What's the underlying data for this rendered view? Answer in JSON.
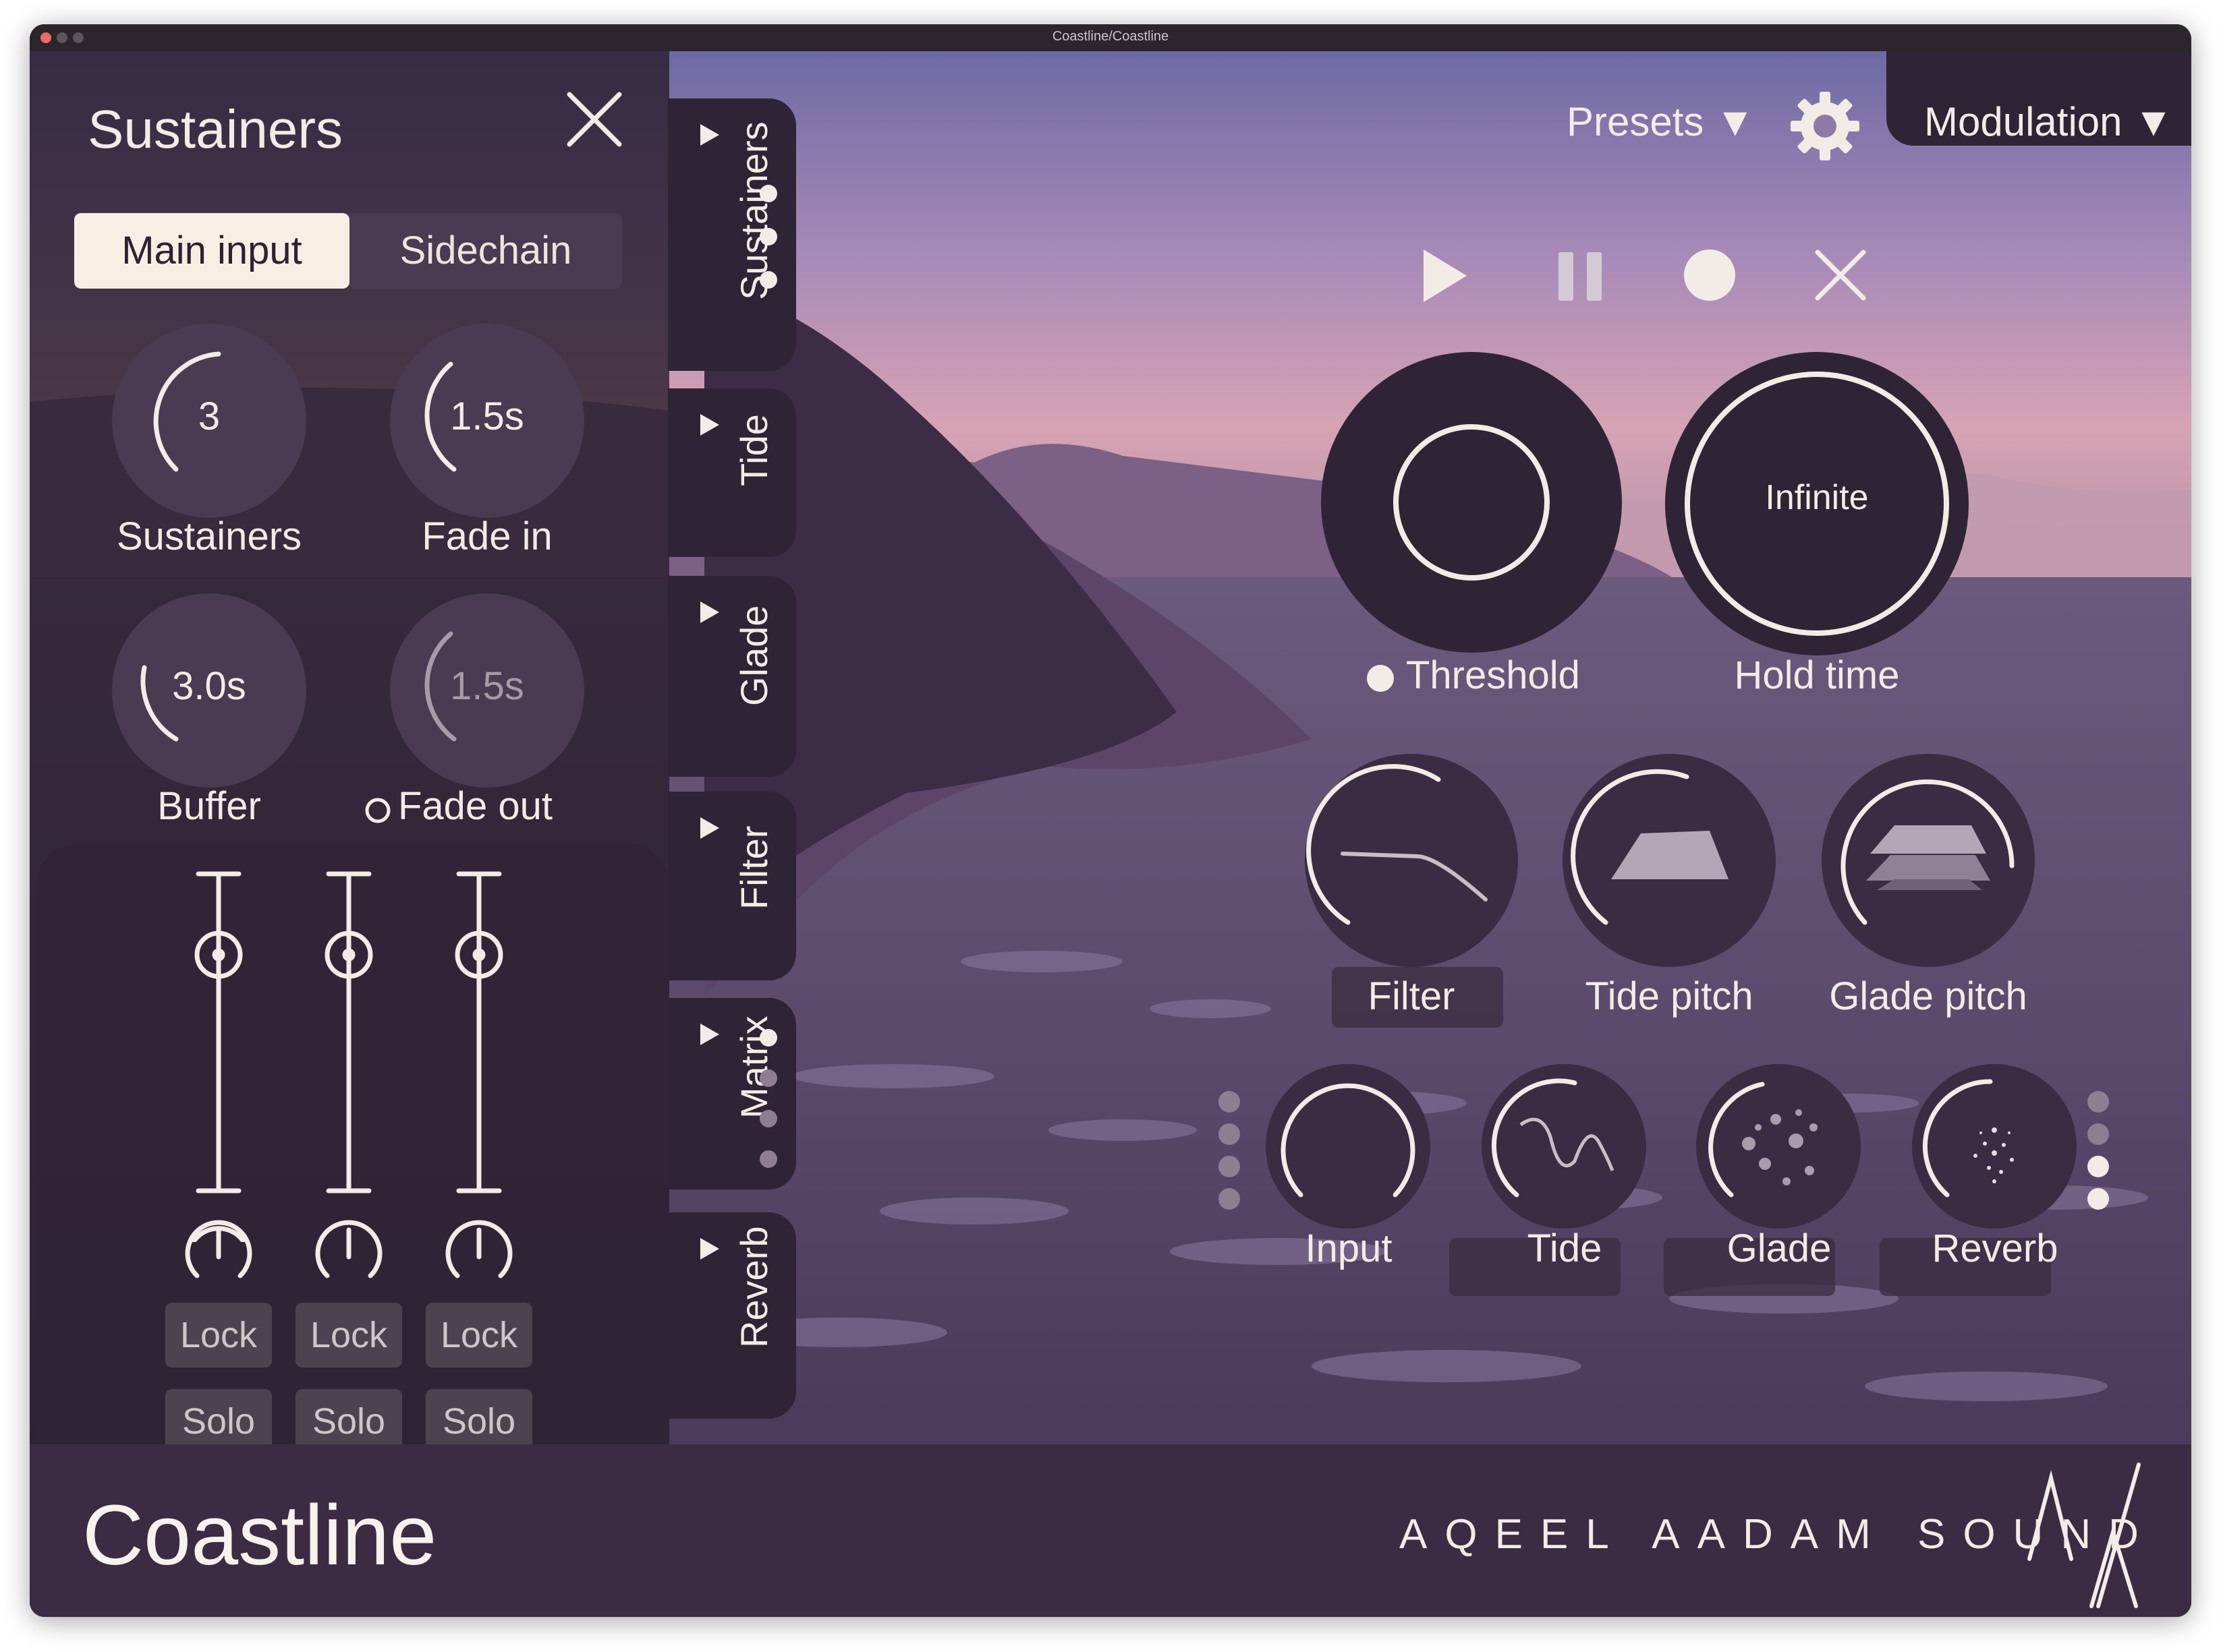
{
  "window": {
    "title": "Coastline/Coastline"
  },
  "panel": {
    "title": "Sustainers",
    "input_tabs": [
      "Main input",
      "Sidechain"
    ],
    "selected_input": "Main input",
    "knobs": [
      {
        "value": "3",
        "label": "Sustainers"
      },
      {
        "value": "1.5s",
        "label": "Fade in"
      },
      {
        "value": "3.0s",
        "label": "Buffer"
      },
      {
        "value": "1.5s",
        "label": "Fade out"
      }
    ],
    "channels": [
      {
        "lock": "Lock",
        "solo": "Solo"
      },
      {
        "lock": "Lock",
        "solo": "Solo"
      },
      {
        "lock": "Lock",
        "solo": "Solo"
      }
    ]
  },
  "side_tabs": [
    "Sustainers",
    "Tide",
    "Glade",
    "Filter",
    "Matrix",
    "Reverb"
  ],
  "header": {
    "presets": "Presets",
    "modulation": "Modulation"
  },
  "main": {
    "threshold_label": "Threshold",
    "hold_value": "Infinite",
    "hold_label": "Hold time",
    "row1": [
      "Filter",
      "Tide pitch",
      "Glade pitch"
    ],
    "row2": [
      "Input",
      "Tide",
      "Glade",
      "Reverb"
    ]
  },
  "footer": {
    "brand": "Coastline",
    "maker": "AQEEL AADAM SOUND"
  },
  "colors": {
    "accent": "#f3ece6",
    "panel": "#2f2435",
    "knob": "#4a3a52"
  }
}
